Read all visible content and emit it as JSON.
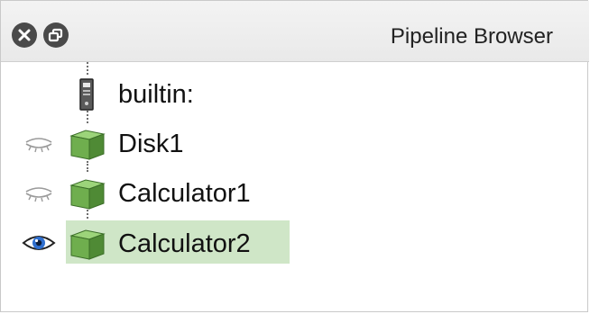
{
  "window": {
    "title": "Pipeline Browser"
  },
  "titlebar": {
    "buttons": [
      {
        "name": "close-icon"
      },
      {
        "name": "float-icon"
      }
    ]
  },
  "pipeline": {
    "items": [
      {
        "label": "builtin:",
        "icon": "server-icon",
        "eye": "none",
        "selected": false
      },
      {
        "label": "Disk1",
        "icon": "green-cube-icon",
        "eye": "eye-closed-icon",
        "selected": false
      },
      {
        "label": "Calculator1",
        "icon": "green-cube-icon",
        "eye": "eye-closed-icon",
        "selected": false
      },
      {
        "label": "Calculator2",
        "icon": "green-cube-icon",
        "eye": "eye-open-icon",
        "selected": true
      }
    ]
  },
  "colors": {
    "selection": "#cfe6c7",
    "cube_front": "#6fae4e",
    "cube_top": "#9cd47a",
    "cube_side": "#4f8a35",
    "eye_iris": "#2f6fcf"
  }
}
